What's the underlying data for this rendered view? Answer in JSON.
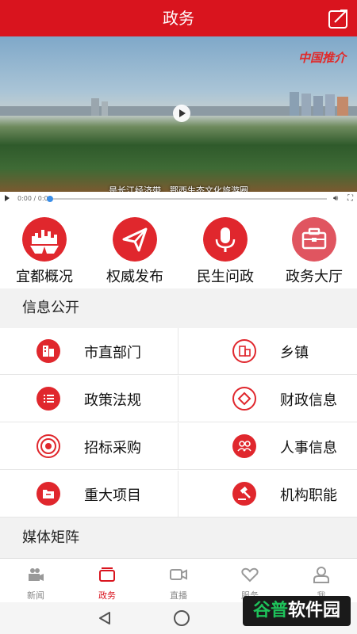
{
  "header": {
    "title": "政务"
  },
  "video": {
    "logo_text": "中国推介",
    "caption": "是长江经济带、鄂西生态文化旅游圈",
    "time": "0:00 / 0:00",
    "progress": 0
  },
  "quick_links": [
    {
      "label": "宜都概况",
      "icon": "city-skyline-icon",
      "color": "#e0272d"
    },
    {
      "label": "权威发布",
      "icon": "paper-plane-icon",
      "color": "#e0272d"
    },
    {
      "label": "民生问政",
      "icon": "microphone-icon",
      "color": "#e0272d"
    },
    {
      "label": "政务大厅",
      "icon": "briefcase-icon",
      "color": "#e05560"
    }
  ],
  "info_section": {
    "title": "信息公开",
    "items": [
      {
        "label": "市直部门",
        "icon": "building-icon"
      },
      {
        "label": "乡镇",
        "icon": "town-icon"
      },
      {
        "label": "政策法规",
        "icon": "list-icon"
      },
      {
        "label": "财政信息",
        "icon": "diamond-icon"
      },
      {
        "label": "招标采购",
        "icon": "target-icon"
      },
      {
        "label": "人事信息",
        "icon": "people-icon"
      },
      {
        "label": "重大项目",
        "icon": "folder-icon"
      },
      {
        "label": "机构职能",
        "icon": "gavel-icon"
      }
    ]
  },
  "media_section": {
    "title": "媒体矩阵"
  },
  "tabbar": {
    "tabs": [
      {
        "label": "新闻",
        "icon": "camera-icon",
        "active": false
      },
      {
        "label": "政务",
        "icon": "window-icon",
        "active": true
      },
      {
        "label": "直播",
        "icon": "video-icon",
        "active": false
      },
      {
        "label": "服务",
        "icon": "heart-hands-icon",
        "active": false
      },
      {
        "label": "我",
        "icon": "user-icon",
        "active": false
      }
    ]
  },
  "watermark": {
    "green": "谷普",
    "white": "软件园"
  },
  "colors": {
    "brand": "#d9141e",
    "accent": "#e0272d"
  }
}
